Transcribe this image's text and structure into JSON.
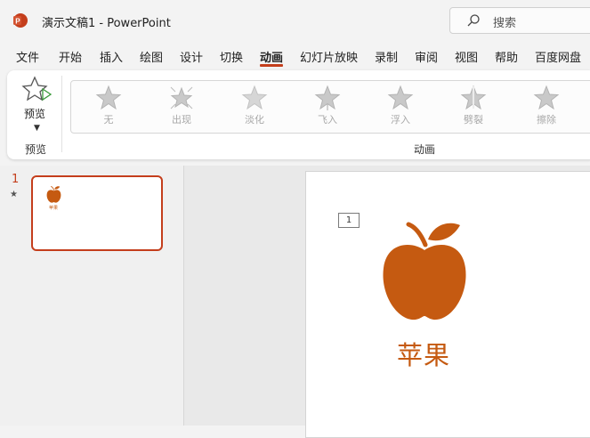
{
  "titlebar": {
    "title": "演示文稿1  -  PowerPoint",
    "search_placeholder": "搜索",
    "logo_color": "#c43e1c"
  },
  "menu": {
    "tabs": [
      "文件",
      "开始",
      "插入",
      "绘图",
      "设计",
      "切换",
      "动画",
      "幻灯片放映",
      "录制",
      "审阅",
      "视图",
      "帮助",
      "百度网盘"
    ],
    "active_tab": "动画"
  },
  "ribbon": {
    "preview": {
      "label": "预览",
      "group_label": "预览"
    },
    "animations": {
      "group_label": "动画",
      "items": [
        "无",
        "出现",
        "淡化",
        "飞入",
        "浮入",
        "劈裂",
        "擦除"
      ]
    }
  },
  "slides_panel": {
    "slide_number": "1",
    "has_animation_marker": "★",
    "thumbnail_caption": "苹果"
  },
  "slide": {
    "animation_tag": "1",
    "caption": "苹果",
    "accent_color": "#c55a11"
  }
}
